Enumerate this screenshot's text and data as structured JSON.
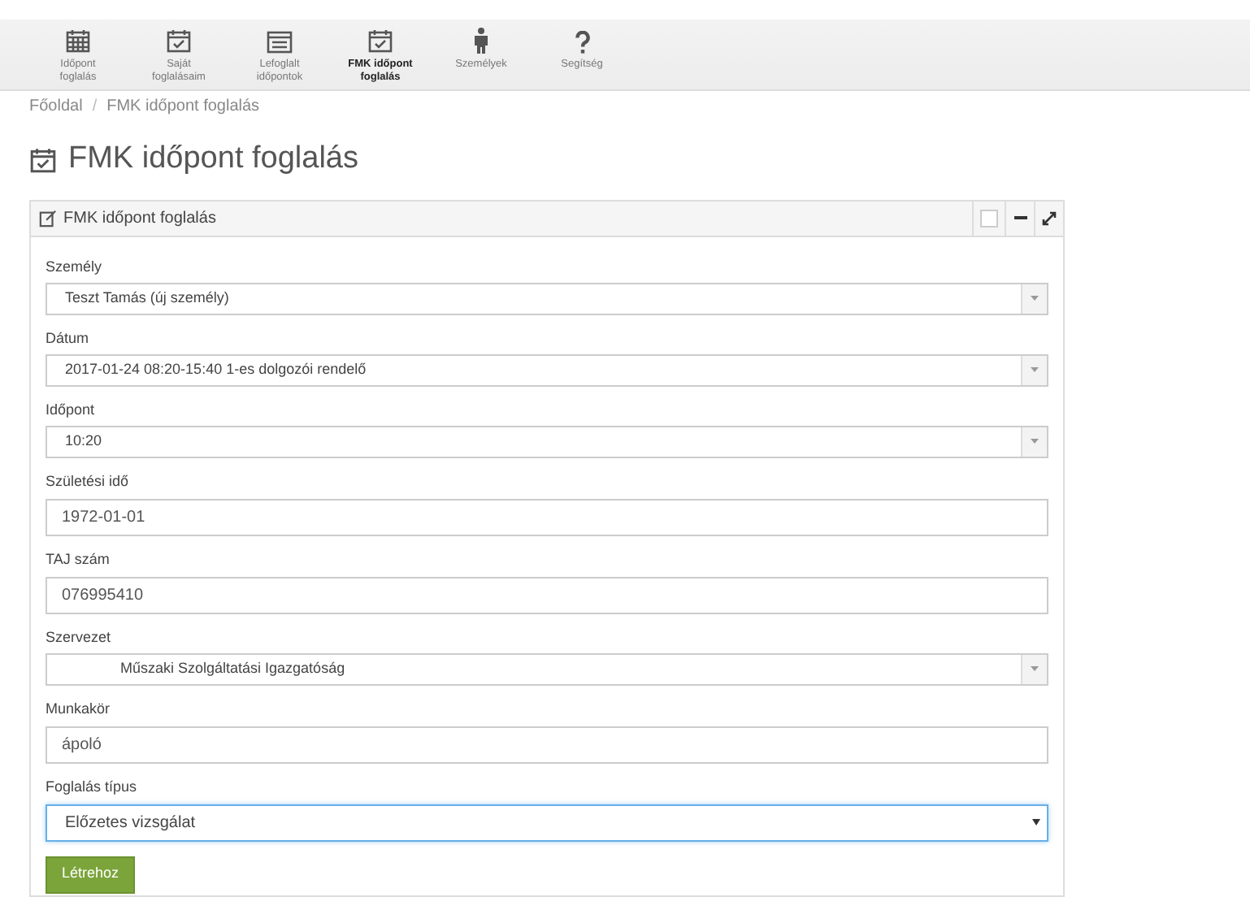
{
  "nav": [
    {
      "label": "Időpont foglalás",
      "kind": "calendar",
      "selected": false
    },
    {
      "label": "Saját foglalásaim",
      "kind": "check",
      "selected": false
    },
    {
      "label": "Lefoglalt időpontok",
      "kind": "list",
      "selected": false
    },
    {
      "label": "FMK időpont foglalás",
      "kind": "check",
      "selected": true
    },
    {
      "label": "Személyek",
      "kind": "person",
      "selected": false
    },
    {
      "label": "Segítség",
      "kind": "help",
      "selected": false
    }
  ],
  "breadcrumb": {
    "items": [
      "Főoldal",
      "FMK időpont foglalás"
    ],
    "separator": "/"
  },
  "page_title": "FMK időpont foglalás",
  "panel": {
    "title": "FMK időpont foglalás",
    "checked": false,
    "fields": [
      {
        "label": "Személy",
        "kind": "combo",
        "value": "Teszt Tamás (új személy)",
        "indented": false,
        "focused": false
      },
      {
        "label": "Dátum",
        "kind": "combo",
        "value": "2017-01-24 08:20-15:40 1-es dolgozói rendelő",
        "indented": false,
        "focused": false
      },
      {
        "label": "Időpont",
        "kind": "combo",
        "value": "10:20",
        "indented": false,
        "focused": false
      },
      {
        "label": "Születési idő",
        "kind": "text",
        "value": "1972-01-01",
        "indented": false,
        "focused": false
      },
      {
        "label": "TAJ szám",
        "kind": "text",
        "value": "076995410",
        "indented": false,
        "focused": false
      },
      {
        "label": "Szervezet",
        "kind": "combo",
        "value": "Műszaki Szolgáltatási Igazgatóság",
        "indented": true,
        "focused": false
      },
      {
        "label": "Munkakör",
        "kind": "text",
        "value": "ápoló",
        "indented": false,
        "focused": false
      },
      {
        "label": "Foglalás típus",
        "kind": "select",
        "value": "Előzetes vizsgálat",
        "indented": false,
        "focused": true
      }
    ],
    "submit": "Létrehoz"
  }
}
